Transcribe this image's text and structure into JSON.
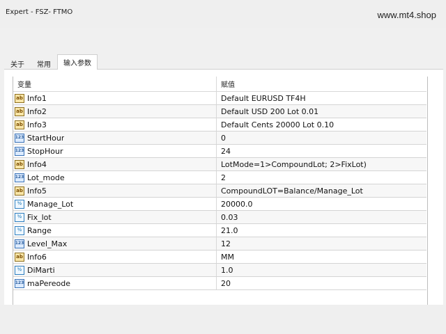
{
  "window": {
    "title": "Expert - FSZ- FTMO",
    "watermark": "www.mt4.shop"
  },
  "tabs": [
    {
      "label": "关于",
      "active": false
    },
    {
      "label": "常用",
      "active": false
    },
    {
      "label": "输入参数",
      "active": true
    }
  ],
  "table": {
    "headers": {
      "name": "变量",
      "value": "赋值"
    },
    "rows": [
      {
        "icon": "ab-icon",
        "name": "Info1",
        "value": "Default EURUSD TF4H"
      },
      {
        "icon": "ab-icon",
        "name": "Info2",
        "value": "Default USD 200 Lot 0.01"
      },
      {
        "icon": "ab-icon",
        "name": "Info3",
        "value": "Default Cents 20000 Lot 0.10"
      },
      {
        "icon": "int-icon",
        "name": "StartHour",
        "value": "0"
      },
      {
        "icon": "int-icon",
        "name": "StopHour",
        "value": "24"
      },
      {
        "icon": "ab-icon",
        "name": "Info4",
        "value": "LotMode=1>CompoundLot; 2>FixLot)"
      },
      {
        "icon": "int-icon",
        "name": "Lot_mode",
        "value": "2"
      },
      {
        "icon": "ab-icon",
        "name": "Info5",
        "value": "CompoundLOT=Balance/Manage_Lot"
      },
      {
        "icon": "num-icon",
        "name": "Manage_Lot",
        "value": "20000.0"
      },
      {
        "icon": "num-icon",
        "name": "Fix_lot",
        "value": "0.03"
      },
      {
        "icon": "num-icon",
        "name": "Range",
        "value": "21.0"
      },
      {
        "icon": "int-icon",
        "name": "Level_Max",
        "value": "12"
      },
      {
        "icon": "ab-icon",
        "name": "Info6",
        "value": "MM"
      },
      {
        "icon": "num-icon",
        "name": "DiMarti",
        "value": "1.0"
      },
      {
        "icon": "int-icon",
        "name": "maPereode",
        "value": "20"
      }
    ]
  },
  "icon_text": {
    "ab": "ab",
    "num": "½",
    "int": "123"
  }
}
